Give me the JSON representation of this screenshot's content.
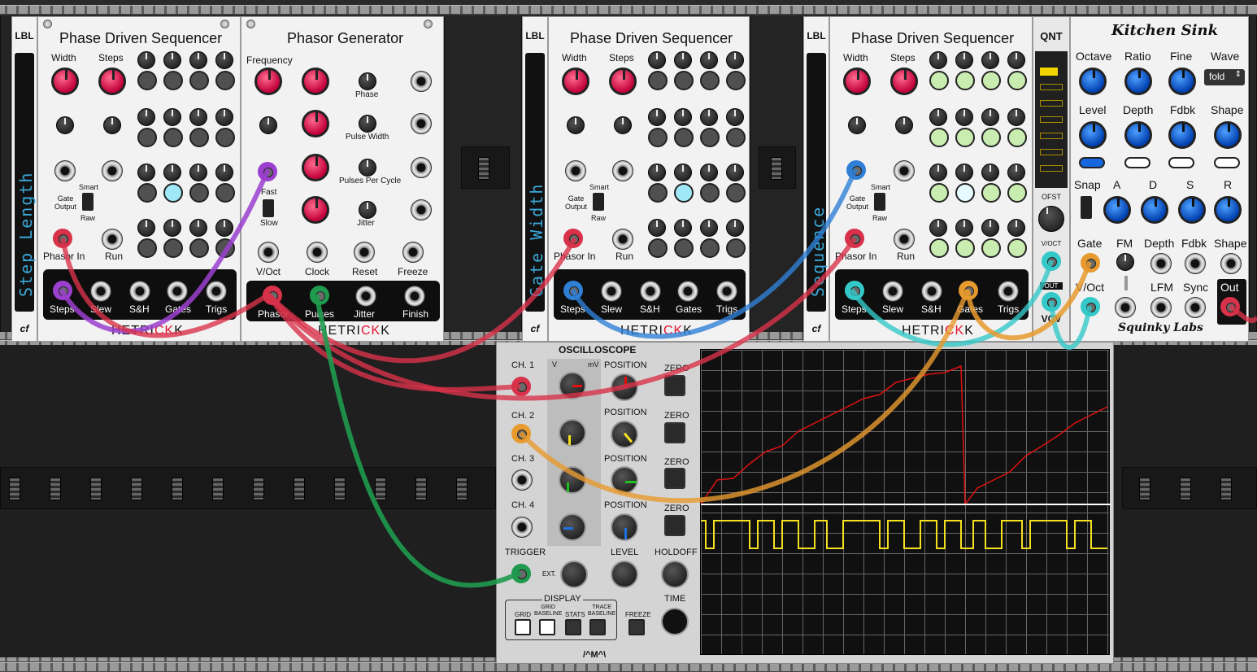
{
  "modules": {
    "lbl1": {
      "badge": "LBL",
      "text": "Step Length",
      "logo": "cf"
    },
    "lbl2": {
      "badge": "LBL",
      "text": "Gate Width",
      "logo": "cf"
    },
    "lbl3": {
      "badge": "LBL",
      "text": "Sequence",
      "logo": "cf"
    },
    "pds": {
      "title": "Phase Driven Sequencer",
      "width": "Width",
      "steps": "Steps",
      "smart": "Smart",
      "gate_output": "Gate\nOutput",
      "raw": "Raw",
      "phasor_in": "Phasor In",
      "run": "Run",
      "outputs": [
        "Steps",
        "Slew",
        "S&H",
        "Gates",
        "Trigs"
      ],
      "brand_a": "HETRI",
      "brand_b": "CK",
      "brand_c": "K"
    },
    "phasor_gen": {
      "title": "Phasor Generator",
      "frequency": "Frequency",
      "fast": "Fast",
      "slow": "Slow",
      "rows": [
        "Phase",
        "Pulse Width",
        "Pulses Per Cycle",
        "Jitter"
      ],
      "inputs": [
        "V/Oct",
        "Clock",
        "Reset",
        "Freeze"
      ],
      "outputs": [
        "Phasor",
        "Pulses",
        "Jitter",
        "Finish"
      ]
    },
    "qnt": {
      "title": "QNT",
      "ofst": "OFST",
      "voct": "V/OCT",
      "out": "OUT",
      "bottom": "VCV"
    },
    "kitchen_sink": {
      "title": "Kitchen Sink",
      "row1": [
        "Octave",
        "Ratio",
        "Fine",
        "Wave"
      ],
      "wave_value": "fold",
      "row2": [
        "Level",
        "Depth",
        "Fdbk",
        "Shape"
      ],
      "row3": [
        "Snap",
        "A",
        "D",
        "S",
        "R"
      ],
      "row4": [
        "Gate",
        "FM",
        "Depth",
        "Fdbk",
        "Shape"
      ],
      "row5": [
        "V/Oct",
        "LFM",
        "Sync",
        "Out"
      ],
      "brand": "Squinky Labs"
    },
    "oscilloscope": {
      "title": "OSCILLOSCOPE",
      "channels": [
        "CH. 1",
        "CH. 2",
        "CH. 3",
        "CH. 4"
      ],
      "position": "POSITION",
      "zero": "ZERO",
      "v": "V",
      "mv": "mV",
      "trigger": "TRIGGER",
      "level": "LEVEL",
      "holdoff": "HOLDOFF",
      "ext": "EXT.",
      "display": "DISPLAY",
      "grid": "GRID",
      "grid_baseline": "GRID\nBASELINE",
      "stats": "STATS",
      "trace_baseline": "TRACE\nBASELINE",
      "freeze": "FREEZE",
      "time": "TIME",
      "logo": "/^M^\\"
    }
  },
  "colors": {
    "cable_purple": "#9b3fcf",
    "cable_red": "#d8324a",
    "cable_green": "#1f9a4e",
    "cable_blue": "#2f7fd6",
    "cable_cyan": "#34c8c8",
    "cable_orange": "#e79a2e",
    "trace_red": "#e01010",
    "trace_yellow": "#f5e020"
  }
}
